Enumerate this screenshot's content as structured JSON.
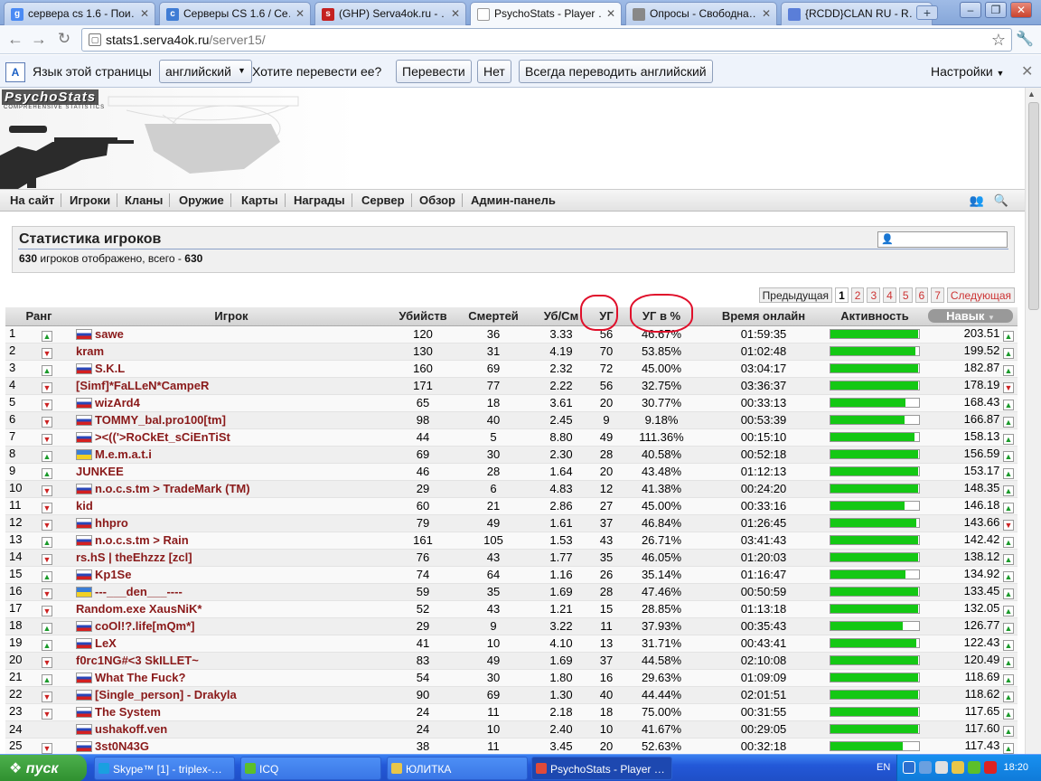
{
  "browser": {
    "tabs": [
      {
        "label": "сервера cs 1.6 - Пои…",
        "favicon_color": "#4a8af4",
        "favicon": "g",
        "active": false
      },
      {
        "label": "Серверы CS 1.6 / Се…",
        "favicon_color": "#3f7cd4",
        "favicon": "c",
        "active": false
      },
      {
        "label": "(GHP) Serva4ok.ru - …",
        "favicon_color": "#c42121",
        "favicon": "s",
        "active": false
      },
      {
        "label": "PsychoStats - Player …",
        "favicon_color": "#ffffff",
        "favicon": "",
        "active": true
      },
      {
        "label": "Опросы - Свободна…",
        "favicon_color": "#888888",
        "favicon": "",
        "active": false
      },
      {
        "label": "{RCDD}CLAN RU - R…",
        "favicon_color": "#5a7ed8",
        "favicon": "",
        "active": false
      }
    ],
    "url_host": "stats1.serva4ok.ru",
    "url_path": "/server15/"
  },
  "translate_bar": {
    "label_lang": "Язык этой страницы",
    "lang_value": "английский",
    "label_question": "Хотите перевести ее?",
    "translate_btn": "Перевести",
    "no_btn": "Нет",
    "always_btn": "Всегда переводить английский",
    "settings": "Настройки"
  },
  "site": {
    "logo": "PsychoStats",
    "logo_sub": "COMPREHENSIVE STATISTICS",
    "nav": [
      "На сайт",
      "Игроки",
      "Кланы",
      "Оружие",
      "Карты",
      "Награды",
      "Сервер",
      "Обзор",
      "Админ-панель"
    ]
  },
  "panel": {
    "title": "Статистика игроков",
    "shown": "630",
    "mid": " игроков отображено, всего - ",
    "total": "630"
  },
  "pager": {
    "prev": "Предыдущая",
    "pages": [
      "1",
      "2",
      "3",
      "4",
      "5",
      "6",
      "7"
    ],
    "current": "1",
    "next": "Следующая"
  },
  "table": {
    "headers": [
      "Ранг",
      "Игрок",
      "Убийств",
      "Смертей",
      "Уб/См",
      "УГ",
      "УГ в %",
      "Время онлайн",
      "Активность",
      "Навык"
    ],
    "rows": [
      {
        "rank": "1",
        "trend": "up",
        "flag": "ru",
        "name": "sawe",
        "kills": "120",
        "deaths": "36",
        "kd": "3.33",
        "hs": "56",
        "hsp": "46.67%",
        "time": "01:59:35",
        "activity": 99,
        "skill": "203.51",
        "strend": "up"
      },
      {
        "rank": "2",
        "trend": "dn",
        "flag": "",
        "name": "kram",
        "kills": "130",
        "deaths": "31",
        "kd": "4.19",
        "hs": "70",
        "hsp": "53.85%",
        "time": "01:02:48",
        "activity": 96,
        "skill": "199.52",
        "strend": "up"
      },
      {
        "rank": "3",
        "trend": "up",
        "flag": "ru",
        "name": "S.K.L",
        "kills": "160",
        "deaths": "69",
        "kd": "2.32",
        "hs": "72",
        "hsp": "45.00%",
        "time": "03:04:17",
        "activity": 99,
        "skill": "182.87",
        "strend": "up"
      },
      {
        "rank": "4",
        "trend": "dn",
        "flag": "",
        "name": "[Simf]*FaLLeN*CampeR",
        "kills": "171",
        "deaths": "77",
        "kd": "2.22",
        "hs": "56",
        "hsp": "32.75%",
        "time": "03:36:37",
        "activity": 99,
        "skill": "178.19",
        "strend": "dn"
      },
      {
        "rank": "5",
        "trend": "dn",
        "flag": "ru",
        "name": "wizArd4",
        "kills": "65",
        "deaths": "18",
        "kd": "3.61",
        "hs": "20",
        "hsp": "30.77%",
        "time": "00:33:13",
        "activity": 85,
        "skill": "168.43",
        "strend": "up"
      },
      {
        "rank": "6",
        "trend": "dn",
        "flag": "ru",
        "name": "TOMMY_bal.pro100[tm]",
        "kills": "98",
        "deaths": "40",
        "kd": "2.45",
        "hs": "9",
        "hsp": "9.18%",
        "time": "00:53:39",
        "activity": 84,
        "skill": "166.87",
        "strend": "up"
      },
      {
        "rank": "7",
        "trend": "dn",
        "flag": "ru",
        "name": "><(('>RoCkEt_sCiEnTiSt",
        "kills": "44",
        "deaths": "5",
        "kd": "8.80",
        "hs": "49",
        "hsp": "111.36%",
        "time": "00:15:10",
        "activity": 95,
        "skill": "158.13",
        "strend": "up"
      },
      {
        "rank": "8",
        "trend": "up",
        "flag": "ua",
        "name": "M.e.m.a.t.i",
        "kills": "69",
        "deaths": "30",
        "kd": "2.30",
        "hs": "28",
        "hsp": "40.58%",
        "time": "00:52:18",
        "activity": 99,
        "skill": "156.59",
        "strend": "up"
      },
      {
        "rank": "9",
        "trend": "up",
        "flag": "",
        "name": "JUNKEE",
        "kills": "46",
        "deaths": "28",
        "kd": "1.64",
        "hs": "20",
        "hsp": "43.48%",
        "time": "01:12:13",
        "activity": 99,
        "skill": "153.17",
        "strend": "up"
      },
      {
        "rank": "10",
        "trend": "dn",
        "flag": "ru",
        "name": "n.o.c.s.tm > TradeMark (TM)",
        "kills": "29",
        "deaths": "6",
        "kd": "4.83",
        "hs": "12",
        "hsp": "41.38%",
        "time": "00:24:20",
        "activity": 99,
        "skill": "148.35",
        "strend": "up"
      },
      {
        "rank": "11",
        "trend": "dn",
        "flag": "",
        "name": "kid",
        "kills": "60",
        "deaths": "21",
        "kd": "2.86",
        "hs": "27",
        "hsp": "45.00%",
        "time": "00:33:16",
        "activity": 84,
        "skill": "146.18",
        "strend": "up"
      },
      {
        "rank": "12",
        "trend": "dn",
        "flag": "ru",
        "name": "hhpro",
        "kills": "79",
        "deaths": "49",
        "kd": "1.61",
        "hs": "37",
        "hsp": "46.84%",
        "time": "01:26:45",
        "activity": 97,
        "skill": "143.66",
        "strend": "dn"
      },
      {
        "rank": "13",
        "trend": "up",
        "flag": "ru",
        "name": "n.o.c.s.tm > Rain",
        "kills": "161",
        "deaths": "105",
        "kd": "1.53",
        "hs": "43",
        "hsp": "26.71%",
        "time": "03:41:43",
        "activity": 99,
        "skill": "142.42",
        "strend": "up"
      },
      {
        "rank": "14",
        "trend": "dn",
        "flag": "",
        "name": "rs.hS | theEhzzz [zcl]",
        "kills": "76",
        "deaths": "43",
        "kd": "1.77",
        "hs": "35",
        "hsp": "46.05%",
        "time": "01:20:03",
        "activity": 99,
        "skill": "138.12",
        "strend": "up"
      },
      {
        "rank": "15",
        "trend": "up",
        "flag": "ru",
        "name": "Kp1Se",
        "kills": "74",
        "deaths": "64",
        "kd": "1.16",
        "hs": "26",
        "hsp": "35.14%",
        "time": "01:16:47",
        "activity": 85,
        "skill": "134.92",
        "strend": "up"
      },
      {
        "rank": "16",
        "trend": "dn",
        "flag": "ua",
        "name": "---___den___----",
        "kills": "59",
        "deaths": "35",
        "kd": "1.69",
        "hs": "28",
        "hsp": "47.46%",
        "time": "00:50:59",
        "activity": 99,
        "skill": "133.45",
        "strend": "up"
      },
      {
        "rank": "17",
        "trend": "dn",
        "flag": "",
        "name": "Random.exe XausNiK*",
        "kills": "52",
        "deaths": "43",
        "kd": "1.21",
        "hs": "15",
        "hsp": "28.85%",
        "time": "01:13:18",
        "activity": 99,
        "skill": "132.05",
        "strend": "up"
      },
      {
        "rank": "18",
        "trend": "up",
        "flag": "ru",
        "name": "coOl!?.life[mQm*]",
        "kills": "29",
        "deaths": "9",
        "kd": "3.22",
        "hs": "11",
        "hsp": "37.93%",
        "time": "00:35:43",
        "activity": 82,
        "skill": "126.77",
        "strend": "up"
      },
      {
        "rank": "19",
        "trend": "up",
        "flag": "ru",
        "name": "LeX",
        "kills": "41",
        "deaths": "10",
        "kd": "4.10",
        "hs": "13",
        "hsp": "31.71%",
        "time": "00:43:41",
        "activity": 97,
        "skill": "122.43",
        "strend": "up"
      },
      {
        "rank": "20",
        "trend": "dn",
        "flag": "",
        "name": "f0rc1NG#<3 SkILLET~",
        "kills": "83",
        "deaths": "49",
        "kd": "1.69",
        "hs": "37",
        "hsp": "44.58%",
        "time": "02:10:08",
        "activity": 99,
        "skill": "120.49",
        "strend": "up"
      },
      {
        "rank": "21",
        "trend": "up",
        "flag": "ru",
        "name": "What The Fuck?",
        "kills": "54",
        "deaths": "30",
        "kd": "1.80",
        "hs": "16",
        "hsp": "29.63%",
        "time": "01:09:09",
        "activity": 99,
        "skill": "118.69",
        "strend": "up"
      },
      {
        "rank": "22",
        "trend": "dn",
        "flag": "ru",
        "name": "[Single_person] - Drakyla",
        "kills": "90",
        "deaths": "69",
        "kd": "1.30",
        "hs": "40",
        "hsp": "44.44%",
        "time": "02:01:51",
        "activity": 99,
        "skill": "118.62",
        "strend": "up"
      },
      {
        "rank": "23",
        "trend": "dn",
        "flag": "ru",
        "name": "The System",
        "kills": "24",
        "deaths": "11",
        "kd": "2.18",
        "hs": "18",
        "hsp": "75.00%",
        "time": "00:31:55",
        "activity": 99,
        "skill": "117.65",
        "strend": "up"
      },
      {
        "rank": "24",
        "trend": "",
        "flag": "ru",
        "name": "ushakoff.ven",
        "kills": "24",
        "deaths": "10",
        "kd": "2.40",
        "hs": "10",
        "hsp": "41.67%",
        "time": "00:29:05",
        "activity": 99,
        "skill": "117.60",
        "strend": "up"
      },
      {
        "rank": "25",
        "trend": "dn",
        "flag": "ru",
        "name": "3st0N43G",
        "kills": "38",
        "deaths": "11",
        "kd": "3.45",
        "hs": "20",
        "hsp": "52.63%",
        "time": "00:32:18",
        "activity": 82,
        "skill": "117.43",
        "strend": "up"
      }
    ]
  },
  "taskbar": {
    "start": "пуск",
    "items": [
      {
        "label": "Skype™ [1] - triplex-…",
        "color": "#1aa0e0"
      },
      {
        "label": "ICQ",
        "color": "#5cbf2a"
      },
      {
        "label": "ЮЛИТКА",
        "color": "#e8c64a"
      },
      {
        "label": "PsychoStats - Player …",
        "color": "#e04a3a"
      }
    ],
    "lang": "EN",
    "clock": "18:20"
  }
}
